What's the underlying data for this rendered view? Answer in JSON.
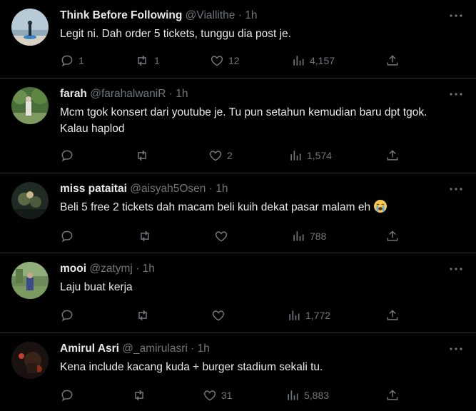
{
  "tweets": [
    {
      "name": "Think Before Following",
      "handle": "@Viallithe",
      "separator": "·",
      "time": "1h",
      "text": "Legit ni. Dah order 5 tickets, tunggu dia post je.",
      "replies": "1",
      "retweets": "1",
      "likes": "12",
      "views": "4,157"
    },
    {
      "name": "farah",
      "handle": "@farahalwaniR",
      "separator": "·",
      "time": "1h",
      "text": "Mcm tgok konsert dari youtube je. Tu pun setahun kemudian baru dpt tgok. Kalau haplod",
      "replies": "",
      "retweets": "",
      "likes": "2",
      "views": "1,574"
    },
    {
      "name": "miss pataitai",
      "handle": "@aisyah5Osen",
      "separator": "·",
      "time": "1h",
      "text": "Beli 5 free 2 tickets dah macam beli kuih dekat pasar malam eh",
      "emoji": "loudly-crying-face",
      "replies": "",
      "retweets": "",
      "likes": "",
      "views": "788"
    },
    {
      "name": "mooi",
      "handle": "@zatymj",
      "separator": "·",
      "time": "1h",
      "text": "Laju buat kerja",
      "replies": "",
      "retweets": "",
      "likes": "",
      "views": "1,772"
    },
    {
      "name": "Amirul Asri",
      "handle": "@_amirulasri",
      "separator": "·",
      "time": "1h",
      "text": "Kena include kacang kuda + burger stadium sekali tu.",
      "replies": "",
      "retweets": "",
      "likes": "31",
      "views": "5,883"
    }
  ],
  "colors": {
    "background": "#000000",
    "text": "#e7e9ea",
    "muted": "#71767b",
    "divider": "#2f3336"
  }
}
